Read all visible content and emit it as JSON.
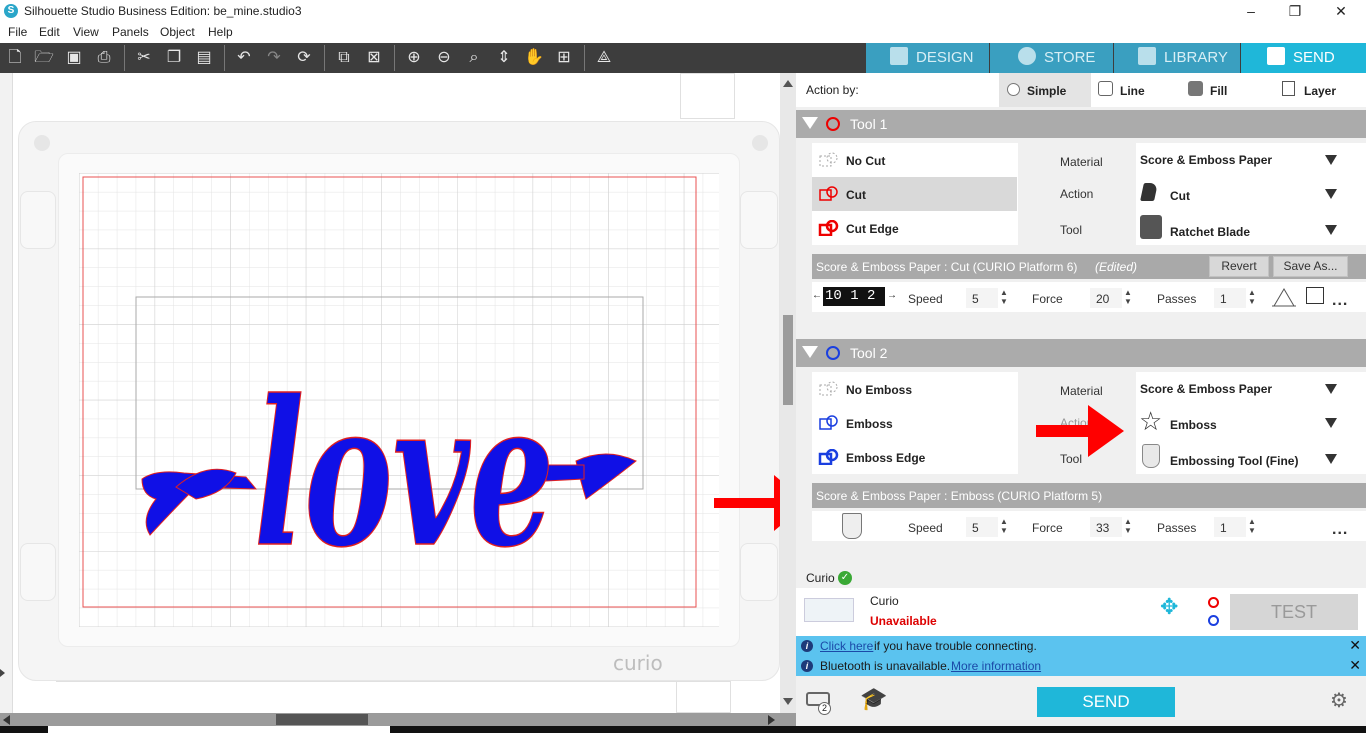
{
  "window": {
    "title": "Silhouette Studio Business Edition: be_mine.studio3",
    "minimize": "–",
    "restore": "❐",
    "close": "✕"
  },
  "menu": [
    "File",
    "Edit",
    "View",
    "Panels",
    "Object",
    "Help"
  ],
  "nav_tabs": [
    "DESIGN",
    "STORE",
    "LIBRARY",
    "SEND"
  ],
  "canvas": {
    "design_text": "love",
    "brand_mark": "curio",
    "design_color": "#1010e6",
    "outline_color": "#e02020",
    "arrow_color": "#ff0000"
  },
  "action_by": {
    "label": "Action by:",
    "options": [
      "Simple",
      "Line",
      "Fill",
      "Layer"
    ],
    "selected": "Simple"
  },
  "tool1": {
    "title": "Tool 1",
    "options": [
      "No Cut",
      "Cut",
      "Cut Edge"
    ],
    "selected": "Cut",
    "material_label": "Material",
    "material_value": "Score & Emboss Paper",
    "action_label": "Action",
    "action_value": "Cut",
    "tool_label": "Tool",
    "tool_value": "Ratchet Blade",
    "preset_text": "Score & Emboss Paper : Cut (CURIO Platform 6)",
    "preset_edited": "(Edited)",
    "revert": "Revert",
    "save_as": "Save As...",
    "blade_readout": "10 1 2",
    "speed_label": "Speed",
    "speed": "5",
    "force_label": "Force",
    "force": "20",
    "passes_label": "Passes",
    "passes": "1"
  },
  "tool2": {
    "title": "Tool 2",
    "options": [
      "No Emboss",
      "Emboss",
      "Emboss Edge"
    ],
    "material_label": "Material",
    "material_value": "Score & Emboss Paper",
    "action_label": "Action",
    "action_value": "Emboss",
    "tool_label": "Tool",
    "tool_value": "Embossing Tool (Fine)",
    "preset_text": "Score & Emboss Paper : Emboss (CURIO Platform 5)",
    "speed_label": "Speed",
    "speed": "5",
    "force_label": "Force",
    "force": "33",
    "passes_label": "Passes",
    "passes": "1"
  },
  "device": {
    "name": "Curio",
    "model": "Curio",
    "status": "Unavailable",
    "test": "TEST"
  },
  "info": {
    "trouble_link": "Click here",
    "trouble_text": "if you have trouble connecting.",
    "bt_text": "Bluetooth is unavailable.",
    "bt_link": "More information"
  },
  "send_button": "SEND",
  "queue_badge": "2"
}
